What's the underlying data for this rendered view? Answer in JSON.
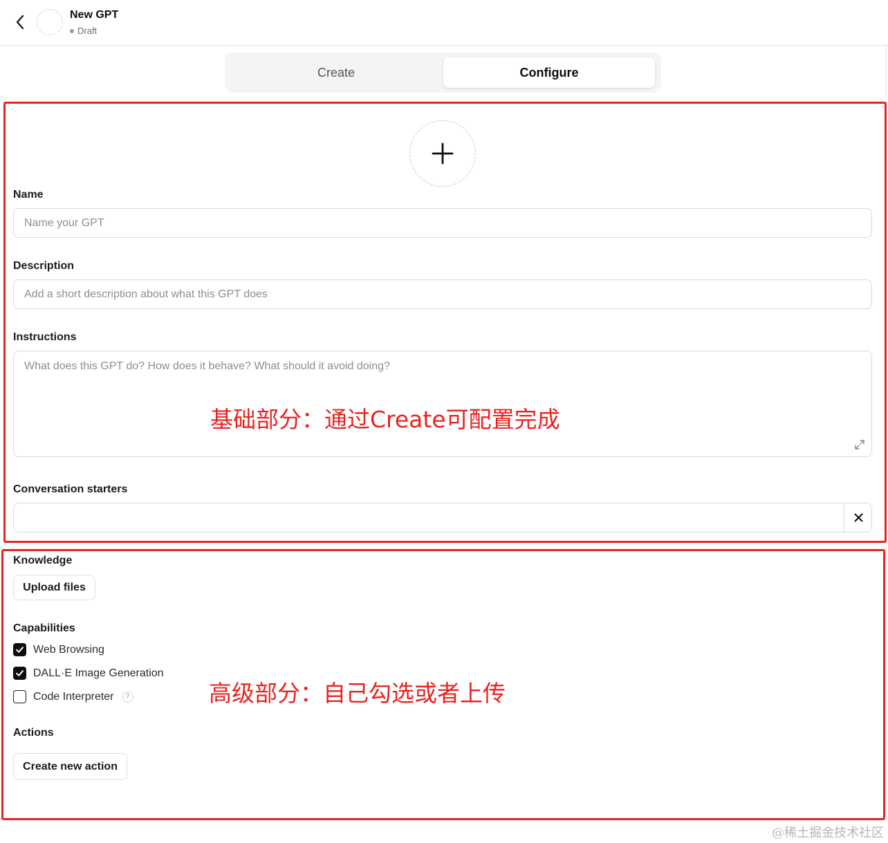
{
  "header": {
    "title": "New GPT",
    "status": "Draft"
  },
  "tabs": [
    {
      "label": "Create",
      "active": false
    },
    {
      "label": "Configure",
      "active": true
    }
  ],
  "form": {
    "name": {
      "label": "Name",
      "placeholder": "Name your GPT",
      "value": ""
    },
    "description": {
      "label": "Description",
      "placeholder": "Add a short description about what this GPT does",
      "value": ""
    },
    "instructions": {
      "label": "Instructions",
      "placeholder": "What does this GPT do? How does it behave? What should it avoid doing?",
      "value": ""
    },
    "conversation_starters": {
      "label": "Conversation starters",
      "value": ""
    }
  },
  "knowledge": {
    "label": "Knowledge",
    "upload_button": "Upload files"
  },
  "capabilities": {
    "label": "Capabilities",
    "items": [
      {
        "label": "Web Browsing",
        "checked": true
      },
      {
        "label": "DALL·E Image Generation",
        "checked": true
      },
      {
        "label": "Code Interpreter",
        "checked": false,
        "help": "?"
      }
    ]
  },
  "actions": {
    "label": "Actions",
    "create_button": "Create new action"
  },
  "annotations": {
    "basic": "基础部分：通过Create可配置完成",
    "advanced": "高级部分：自己勾选或者上传"
  },
  "watermark": "@稀土掘金技术社区",
  "colors": {
    "annotation_red": "#e8231f",
    "checkbox_on": "#0d0d0d"
  }
}
